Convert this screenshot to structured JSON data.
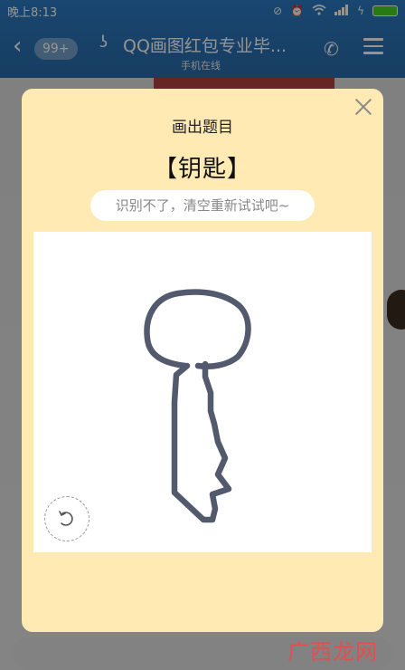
{
  "status_bar": {
    "time": "晚上8:13",
    "icons": [
      "mute-icon",
      "alarm-icon",
      "wifi-icon",
      "signal-icon",
      "charging-icon",
      "battery-icon"
    ]
  },
  "chat_header": {
    "unread_count": "99+",
    "title": "QQ画图红包专业毕...",
    "subtitle": "手机在线"
  },
  "dialog": {
    "heading": "画出题目",
    "prompt_word": "【钥匙】",
    "hint": "识别不了，清空重新试试吧~",
    "accent_color": "#ffeab3"
  },
  "watermark": "广西龙网"
}
